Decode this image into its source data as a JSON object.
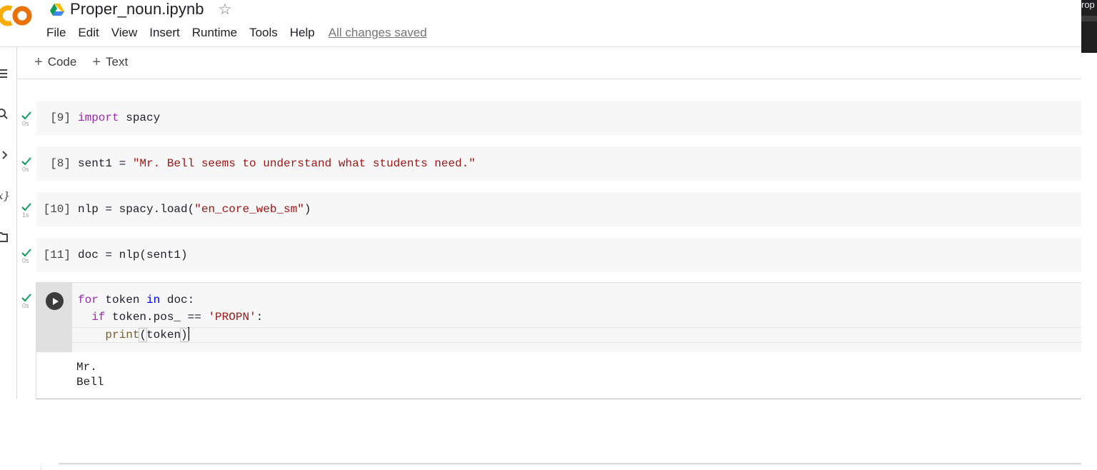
{
  "app": {
    "file_title": "Proper_noun.ipynb",
    "corner_text": "rop"
  },
  "menu": {
    "items": [
      "File",
      "Edit",
      "View",
      "Insert",
      "Runtime",
      "Tools",
      "Help"
    ],
    "save_status": "All changes saved"
  },
  "toolbar": {
    "add_code_label": "Code",
    "add_text_label": "Text",
    "plus_glyph": "+"
  },
  "rail": {
    "icons": [
      "toc-icon",
      "search-icon",
      "chevron-right-icon",
      "variables-icon",
      "folder-icon"
    ],
    "variables_glyph": "x}"
  },
  "colors": {
    "check": "#0f9d58",
    "keyword_purple": "#9c27b0",
    "string_red": "#a31515",
    "cell_bg": "#f7f7f7"
  },
  "cells": [
    {
      "exec_count": "[9]",
      "duration": "0s",
      "code": {
        "kw": "import",
        "rest": " spacy"
      }
    },
    {
      "exec_count": "[8]",
      "duration": "0s",
      "code": {
        "pre": "sent1 = ",
        "str": "\"Mr. Bell seems to understand what students need.\""
      }
    },
    {
      "exec_count": "[10]",
      "duration": "1s",
      "code": {
        "pre": "nlp = spacy.load(",
        "str": "\"en_core_web_sm\"",
        "post": ")"
      }
    },
    {
      "exec_count": "[11]",
      "duration": "0s",
      "code": {
        "pre": "doc = nlp(sent1)"
      }
    }
  ],
  "active_cell": {
    "duration": "0s",
    "line1": {
      "kw": "for",
      "mid": " token ",
      "kw2": "in",
      "rest": " doc:"
    },
    "line2": {
      "indent": "  ",
      "kw": "if",
      "mid": " token.pos_ == ",
      "str": "'PROPN'",
      "rest": ":"
    },
    "line3": {
      "indent": "    ",
      "fn": "print",
      "open": "(",
      "arg": "token",
      "close": ")"
    },
    "output": [
      "Mr.",
      "Bell"
    ]
  }
}
